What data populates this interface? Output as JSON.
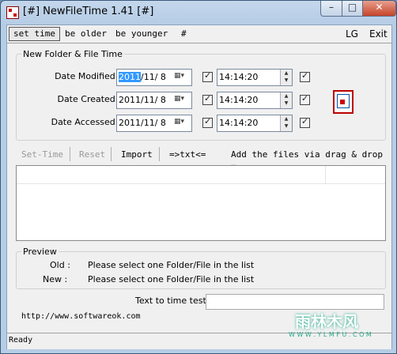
{
  "window": {
    "title": "[#] NewFileTime 1.41 [#]",
    "min": "–",
    "max": "□",
    "close": "✕"
  },
  "menu": [
    {
      "label": "set time"
    },
    {
      "label": "be older"
    },
    {
      "label": "be younger"
    },
    {
      "label": "#"
    },
    {
      "label": "LG"
    },
    {
      "label": "Exit"
    }
  ],
  "group1": {
    "title": "New Folder & File Time",
    "rows": [
      {
        "label": "Date Modified :",
        "date_sel": "2011",
        "date_rest": "/11/  8",
        "time": "14:14:20"
      },
      {
        "label": "Date Created :",
        "date_sel": "",
        "date_rest": "2011/11/  8",
        "time": "14:14:20"
      },
      {
        "label": "Date Accessed :",
        "date_sel": "",
        "date_rest": "2011/11/  8",
        "time": "14:14:20"
      }
    ]
  },
  "toolbar": {
    "set_time": "Set-Time",
    "reset": "Reset",
    "import": "Import",
    "txt": "=>txt<=",
    "drag": "Add the files via drag & drop ▼"
  },
  "preview": {
    "title": "Preview",
    "old_label": "Old :",
    "old_text": "Please select one Folder/File in the list",
    "new_label": "New :",
    "new_text": "Please select one Folder/File in the list"
  },
  "tester": {
    "label": "Text to time tester",
    "value": ""
  },
  "url": "http://www.softwareok.com",
  "status": "Ready",
  "watermark": {
    "text1": "雨林木风",
    "text2": "W W W . Y L M F U . C O M"
  }
}
